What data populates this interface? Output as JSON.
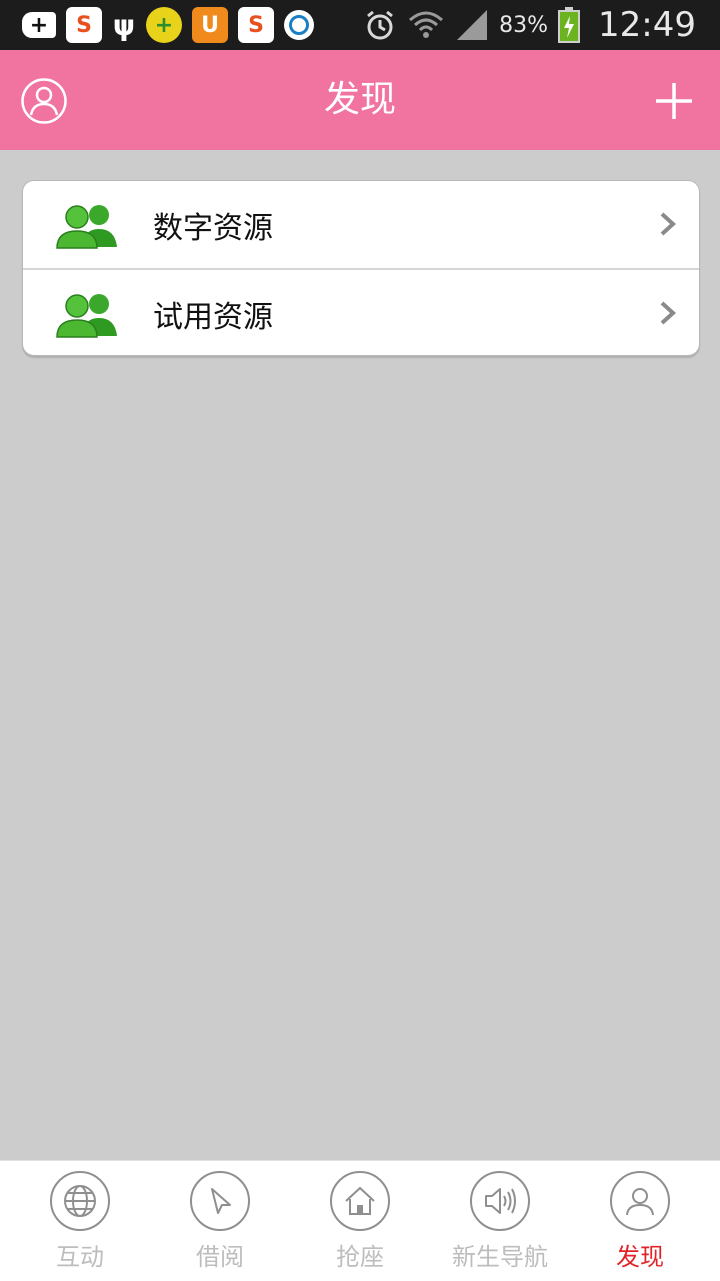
{
  "statusbar": {
    "battery": "83%",
    "time": "12:49"
  },
  "header": {
    "title": "发现"
  },
  "list": {
    "items": [
      {
        "label": "数字资源"
      },
      {
        "label": "试用资源"
      }
    ]
  },
  "bottomnav": {
    "tabs": [
      {
        "label": "互动"
      },
      {
        "label": "借阅"
      },
      {
        "label": "抢座"
      },
      {
        "label": "新生导航"
      },
      {
        "label": "发现"
      }
    ],
    "active_color": "#e0252a",
    "inactive_color": "#bdbdbd"
  },
  "colors": {
    "header": "#f073a0",
    "background": "#cccccc"
  }
}
